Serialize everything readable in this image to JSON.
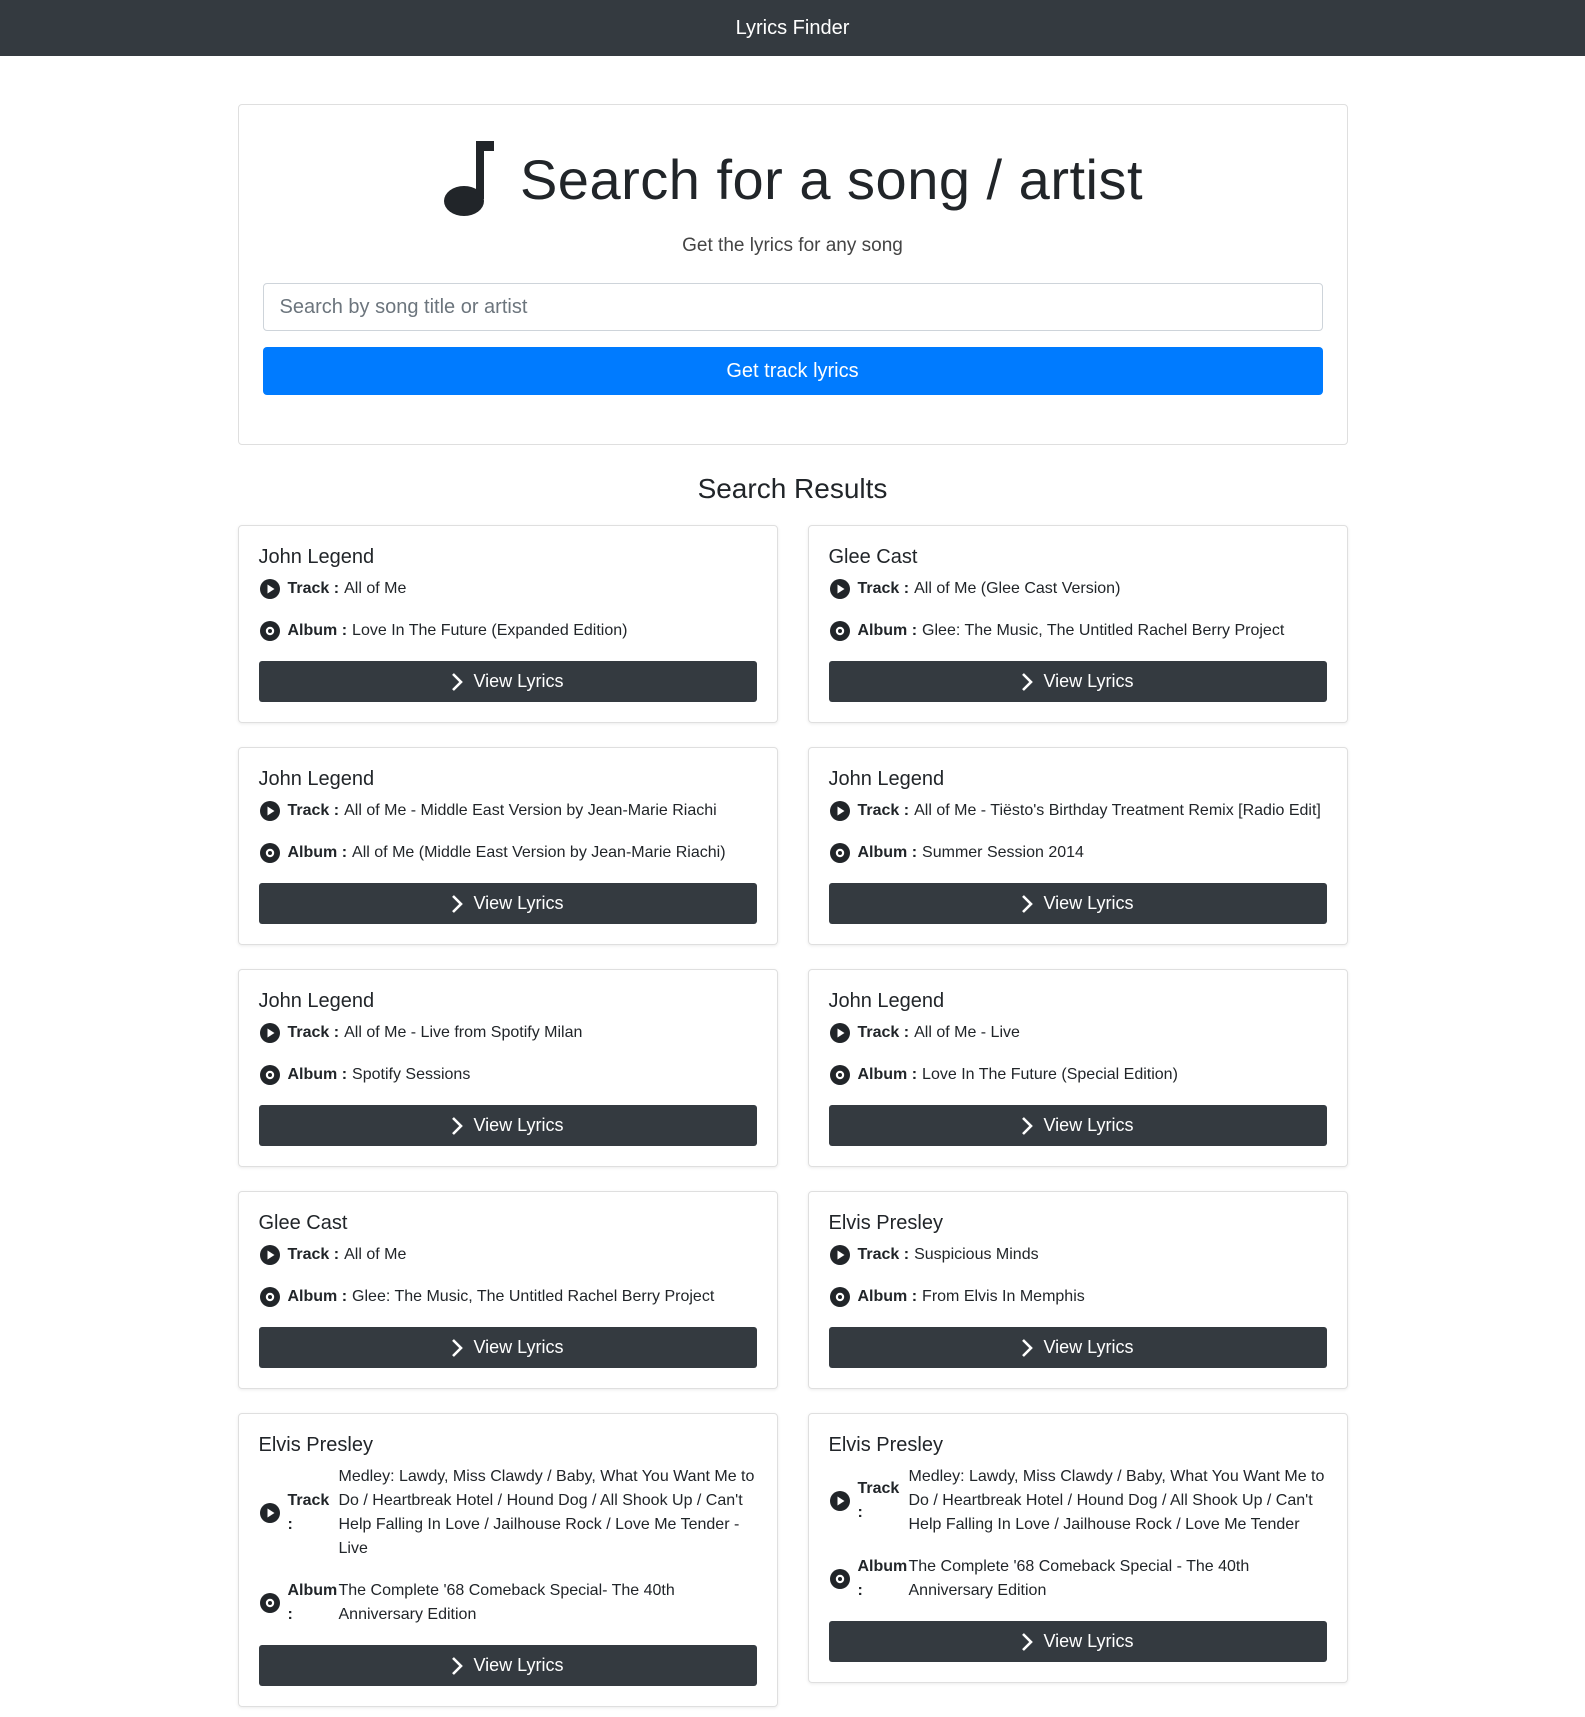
{
  "navbar": {
    "brand": "Lyrics Finder"
  },
  "hero": {
    "title": "Search for a song / artist",
    "subtitle": "Get the lyrics for any song",
    "search_placeholder": "Search by song title or artist",
    "search_value": "",
    "submit_label": "Get track lyrics"
  },
  "results": {
    "heading": "Search Results",
    "track_key": "Track :",
    "album_key": "Album :",
    "view_label": "View Lyrics",
    "items": [
      {
        "artist": "John Legend",
        "track": "All of Me",
        "album": "Love In The Future (Expanded Edition)"
      },
      {
        "artist": "Glee Cast",
        "track": "All of Me (Glee Cast Version)",
        "album": "Glee: The Music, The Untitled Rachel Berry Project"
      },
      {
        "artist": "John Legend",
        "track": "All of Me - Middle East Version by Jean-Marie Riachi",
        "album": "All of Me (Middle East Version by Jean-Marie Riachi)"
      },
      {
        "artist": "John Legend",
        "track": "All of Me - Tiësto's Birthday Treatment Remix [Radio Edit]",
        "album": "Summer Session 2014"
      },
      {
        "artist": "John Legend",
        "track": "All of Me - Live from Spotify Milan",
        "album": "Spotify Sessions"
      },
      {
        "artist": "John Legend",
        "track": "All of Me - Live",
        "album": "Love In The Future (Special Edition)"
      },
      {
        "artist": "Glee Cast",
        "track": "All of Me",
        "album": "Glee: The Music, The Untitled Rachel Berry Project"
      },
      {
        "artist": "Elvis Presley",
        "track": "Suspicious Minds",
        "album": "From Elvis In Memphis"
      },
      {
        "artist": "Elvis Presley",
        "track": "Medley: Lawdy, Miss Clawdy / Baby, What You Want Me to Do / Heartbreak Hotel / Hound Dog / All Shook Up / Can't Help Falling In Love / Jailhouse Rock / Love Me Tender - Live",
        "album": "The Complete '68 Comeback Special- The 40th Anniversary Edition"
      },
      {
        "artist": "Elvis Presley",
        "track": "Medley: Lawdy, Miss Clawdy / Baby, What You Want Me to Do / Heartbreak Hotel / Hound Dog / All Shook Up / Can't Help Falling In Love / Jailhouse Rock / Love Me Tender",
        "album": "The Complete '68 Comeback Special - The 40th Anniversary Edition"
      }
    ]
  }
}
